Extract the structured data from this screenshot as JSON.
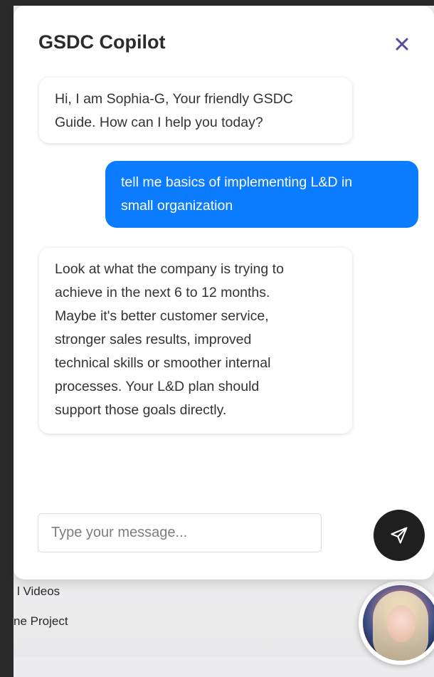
{
  "chat": {
    "title": "GSDC Copilot",
    "messages": [
      {
        "role": "bot",
        "text": "Hi, I am Sophia-G, Your friendly GSDC\nGuide. How can I help you today?"
      },
      {
        "role": "user",
        "text": "tell me basics of implementing L&D in\nsmall organization"
      },
      {
        "role": "bot",
        "text": "Look at what the company is trying to\nachieve in the next 6 to 12 months.\nMaybe it's better customer service,\nstronger sales results, improved\ntechnical skills or smoother internal\nprocesses. Your L&D plan should\nsupport those goals directly."
      }
    ],
    "input": {
      "placeholder": "Type your message...",
      "value": ""
    },
    "icons": {
      "close": "close-icon",
      "send": "send-icon"
    },
    "colors": {
      "user_bubble": "#0b7cff",
      "close_icon": "#5a4c9a",
      "send_button": "#1f1f1f"
    }
  },
  "background_page": {
    "items": [
      "l Videos",
      "ne Project"
    ]
  }
}
